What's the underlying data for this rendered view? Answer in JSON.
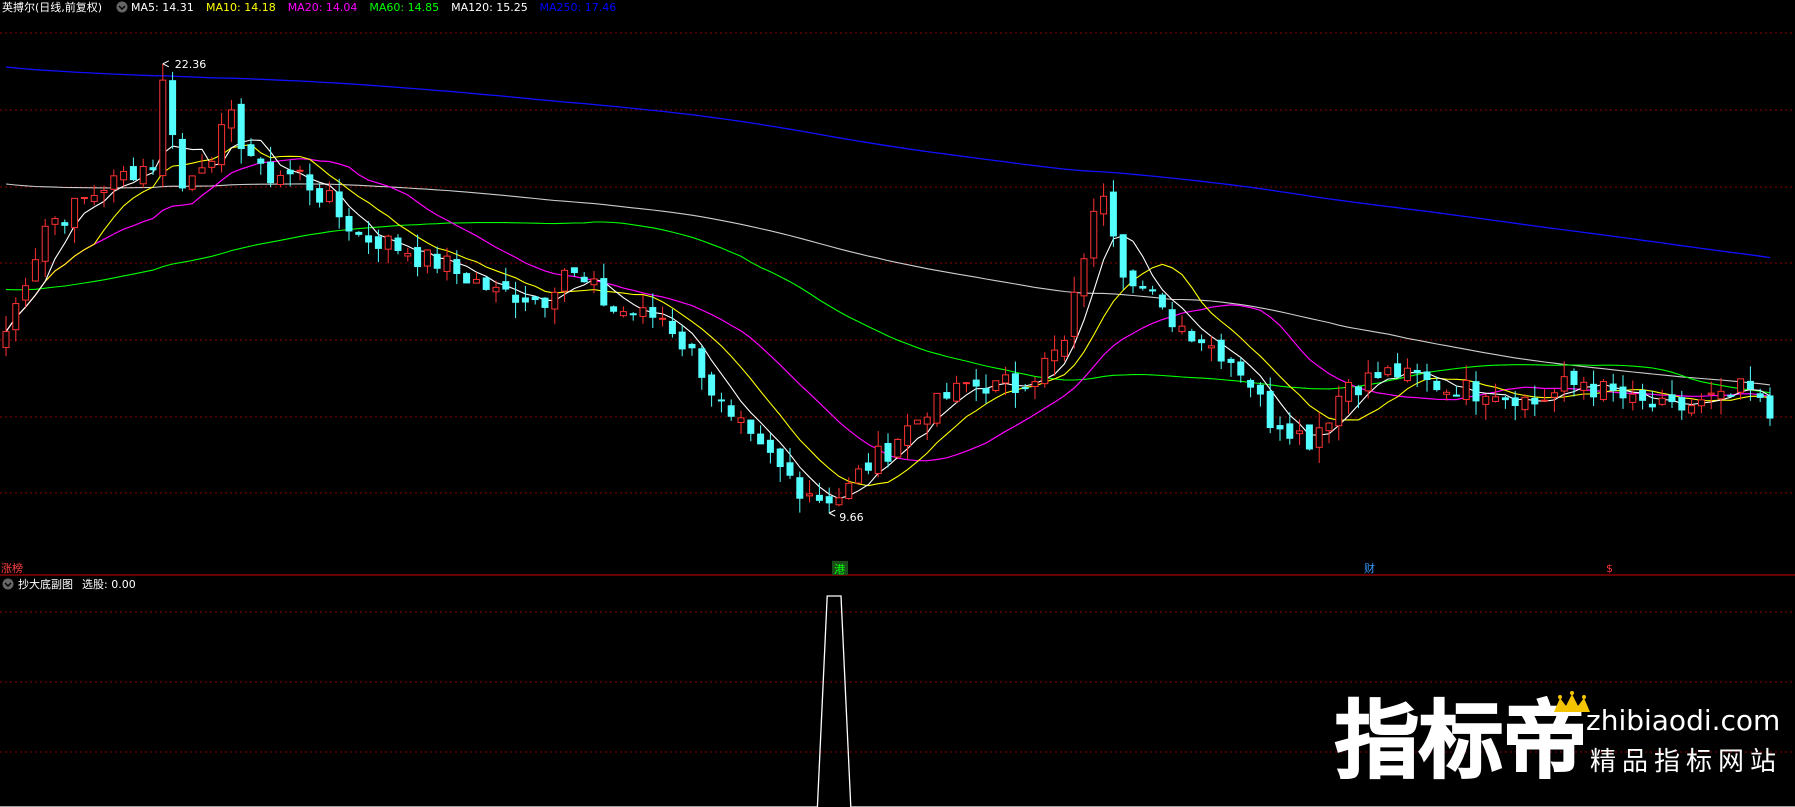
{
  "header": {
    "title": "英搏尔(日线,前复权)",
    "ma_items": [
      {
        "text": "MA5: 14.31",
        "color": "#ffffff"
      },
      {
        "text": "MA10: 14.18",
        "color": "#ffff00"
      },
      {
        "text": "MA20: 14.04",
        "color": "#ff00ff"
      },
      {
        "text": "MA60: 14.85",
        "color": "#00ff00"
      },
      {
        "text": "MA120: 15.25",
        "color": "#ffffff"
      },
      {
        "text": "MA250: 17.46",
        "color": "#0000ff"
      }
    ]
  },
  "annotations": {
    "high": "22.36",
    "low": "9.66"
  },
  "event_bar": {
    "left_label": "涨榜",
    "markers": [
      {
        "text": "港",
        "color": "#00ff00"
      },
      {
        "text": "财",
        "color": "#3399ff"
      },
      {
        "text": "$",
        "color": "#ff3333"
      }
    ]
  },
  "sub_panel": {
    "title": "抄大底副图",
    "value_label": "选股: 0.00"
  },
  "watermark": {
    "brand": "指标帝",
    "domain": "zhibiaodi.com",
    "tagline": "精品指标网站"
  },
  "colors": {
    "up": "#ff3232",
    "down": "#54ffff",
    "grid": "#8b0000",
    "ma5": "#ffffff",
    "ma10": "#ffff00",
    "ma20": "#ff00ff",
    "ma60": "#00ff00",
    "ma120": "#cccccc",
    "ma250": "#1010ff"
  },
  "chart_data": {
    "type": "candlestick",
    "ylim": [
      8.9,
      23.6
    ],
    "price_anchors": [
      [
        0,
        14.8
      ],
      [
        4,
        17.8
      ],
      [
        10,
        18.9
      ],
      [
        15,
        19.6
      ],
      [
        16,
        22.3
      ],
      [
        18,
        18.8
      ],
      [
        23,
        20.8
      ],
      [
        26,
        19.3
      ],
      [
        30,
        19.2
      ],
      [
        36,
        17.5
      ],
      [
        42,
        17.0
      ],
      [
        50,
        15.9
      ],
      [
        55,
        15.7
      ],
      [
        57,
        16.6
      ],
      [
        62,
        15.4
      ],
      [
        67,
        15.2
      ],
      [
        70,
        14.2
      ],
      [
        74,
        12.2
      ],
      [
        79,
        10.9
      ],
      [
        84,
        9.9
      ],
      [
        86,
        10.4
      ],
      [
        89,
        11.3
      ],
      [
        94,
        12.6
      ],
      [
        98,
        13.3
      ],
      [
        103,
        13.2
      ],
      [
        108,
        14.4
      ],
      [
        110,
        17.0
      ],
      [
        112,
        18.8
      ],
      [
        114,
        16.7
      ],
      [
        118,
        15.3
      ],
      [
        122,
        14.6
      ],
      [
        126,
        13.8
      ],
      [
        129,
        12.4
      ],
      [
        133,
        11.7
      ],
      [
        137,
        13.4
      ],
      [
        142,
        13.6
      ],
      [
        147,
        13.2
      ],
      [
        151,
        13.2
      ],
      [
        156,
        12.8
      ],
      [
        161,
        13.4
      ],
      [
        166,
        12.8
      ],
      [
        170,
        12.6
      ],
      [
        174,
        12.8
      ],
      [
        178,
        13.1
      ],
      [
        180,
        12.4
      ]
    ],
    "ma_current": {
      "MA5": 14.31,
      "MA10": 14.18,
      "MA20": 14.04,
      "MA60": 14.85,
      "MA120": 15.25,
      "MA250": 17.46
    },
    "sub_signal": {
      "spike_range": [
        83,
        86
      ],
      "value": 1,
      "baseline": 0
    }
  }
}
